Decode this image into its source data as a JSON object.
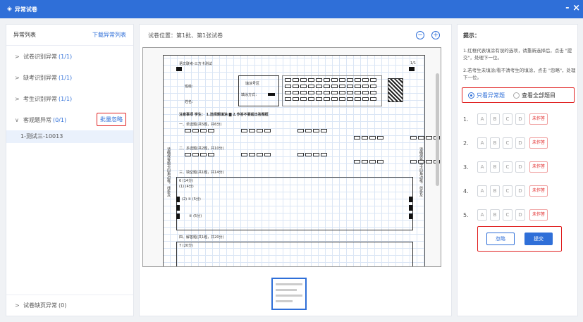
{
  "window": {
    "title": "异常试卷",
    "close_label": "- ×"
  },
  "left": {
    "header_title": "异常列表",
    "download_label": "下载异常列表",
    "categories": [
      {
        "label": "试卷识别异常",
        "count": "(1/1)"
      },
      {
        "label": "缺考识别异常",
        "count": "(1/1)"
      },
      {
        "label": "考生识别异常",
        "count": "(1/1)"
      },
      {
        "label": "客观题异常",
        "count": "(0/1)"
      }
    ],
    "ignore_all_label": "批量忽略",
    "sub_item": "1-测试三-10013",
    "bottom_category": {
      "label": "试卷缺页异常",
      "count": "(0)"
    }
  },
  "center": {
    "location": "试卷位置：第1批、第1张试卷",
    "zoom_out": "−",
    "zoom_in": "+",
    "sheet": {
      "header": "语文联考-三方卡测试",
      "page": "1/1",
      "class_label": "班级：",
      "name_label": "姓名：",
      "id_zone": "填涂号区",
      "fill_method": "填涂方式：",
      "notice": "注意事项  学生：  1.选择题填涂 ▇  2.作答不要超出答题框",
      "s1": "一、单选题(共5题，共6分)",
      "s2": "二、多选题(共2题，共10分)",
      "s3": "三、填空题(共1题，共14分)",
      "q6": "6 (14分)",
      "q6a": "(1) (4分)",
      "q6b": "(2) ① (5分)",
      "q6c": "② (5分)",
      "s4": "四、解答题(共1题，共20分)",
      "q7": "7 (20分)",
      "side_left": "请确保答题卡四角边框，线条及",
      "side_right": "请确保答题卡四角边框，线条及"
    }
  },
  "right": {
    "title": "提示：",
    "tip1": "1.红框代表填涂有误的选项，请重新选择后，点击 \"提交\"，处理下一位。",
    "tip2": "2.若考生未填涂/看不清考生的填涂，点击 \"忽略\"，处理下一位。",
    "radio_only": "只看异常题",
    "radio_all": "查看全部题目",
    "questions": [
      {
        "num": "1.",
        "options": [
          "A",
          "B",
          "C",
          "D"
        ],
        "status": "未作答"
      },
      {
        "num": "2.",
        "options": [
          "A",
          "B",
          "C",
          "D"
        ],
        "status": "未作答"
      },
      {
        "num": "3.",
        "options": [
          "A",
          "B",
          "C",
          "D"
        ],
        "status": "未作答"
      },
      {
        "num": "4.",
        "options": [
          "A",
          "B",
          "C",
          "D"
        ],
        "status": "未作答"
      },
      {
        "num": "5.",
        "options": [
          "A",
          "B",
          "C",
          "D"
        ],
        "status": "未作答"
      }
    ],
    "ignore_label": "忽略",
    "submit_label": "提交"
  }
}
